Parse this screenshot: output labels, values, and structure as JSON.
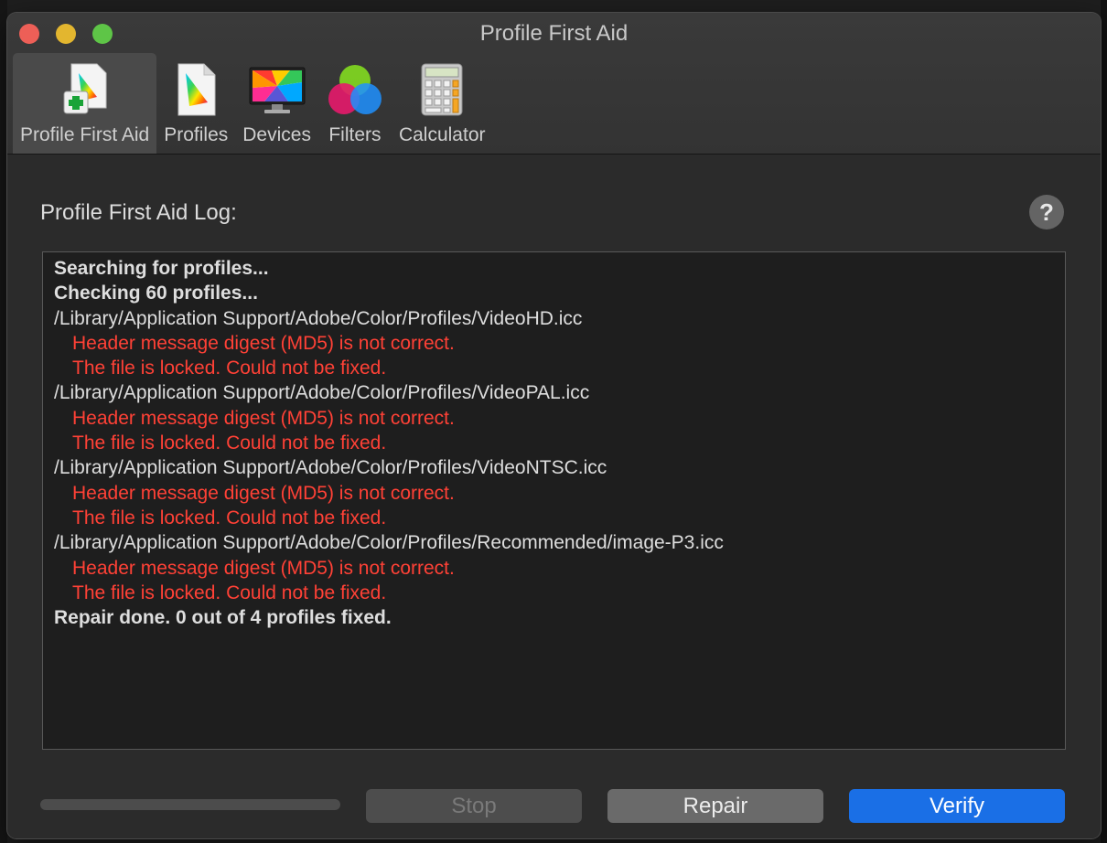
{
  "window": {
    "title": "Profile First Aid"
  },
  "toolbar": {
    "items": [
      {
        "label": "Profile First Aid",
        "icon": "first-aid-profile-icon",
        "active": true
      },
      {
        "label": "Profiles",
        "icon": "profile-document-icon",
        "active": false
      },
      {
        "label": "Devices",
        "icon": "display-monitor-icon",
        "active": false
      },
      {
        "label": "Filters",
        "icon": "color-filters-icon",
        "active": false
      },
      {
        "label": "Calculator",
        "icon": "calculator-icon",
        "active": false
      }
    ]
  },
  "log": {
    "title": "Profile First Aid Log:",
    "help_label": "?",
    "lines": [
      {
        "text": "Searching for profiles...",
        "style": "bold"
      },
      {
        "text": "Checking 60 profiles...",
        "style": "bold"
      },
      {
        "text": "/Library/Application Support/Adobe/Color/Profiles/VideoHD.icc",
        "style": "path"
      },
      {
        "text": "Header message digest (MD5) is not correct.",
        "style": "error"
      },
      {
        "text": "The file is locked. Could not be fixed.",
        "style": "error"
      },
      {
        "text": "/Library/Application Support/Adobe/Color/Profiles/VideoPAL.icc",
        "style": "path"
      },
      {
        "text": "Header message digest (MD5) is not correct.",
        "style": "error"
      },
      {
        "text": "The file is locked. Could not be fixed.",
        "style": "error"
      },
      {
        "text": "/Library/Application Support/Adobe/Color/Profiles/VideoNTSC.icc",
        "style": "path"
      },
      {
        "text": "Header message digest (MD5) is not correct.",
        "style": "error"
      },
      {
        "text": "The file is locked. Could not be fixed.",
        "style": "error"
      },
      {
        "text": "/Library/Application Support/Adobe/Color/Profiles/Recommended/image-P3.icc",
        "style": "path"
      },
      {
        "text": "Header message digest (MD5) is not correct.",
        "style": "error"
      },
      {
        "text": "The file is locked. Could not be fixed.",
        "style": "error"
      },
      {
        "text": "Repair done. 0 out of 4 profiles fixed.",
        "style": "bold"
      }
    ]
  },
  "progress": {
    "value": 0
  },
  "buttons": {
    "stop": "Stop",
    "repair": "Repair",
    "verify": "Verify"
  },
  "colors": {
    "accent": "#1a6fe6",
    "error": "#ff4136"
  }
}
